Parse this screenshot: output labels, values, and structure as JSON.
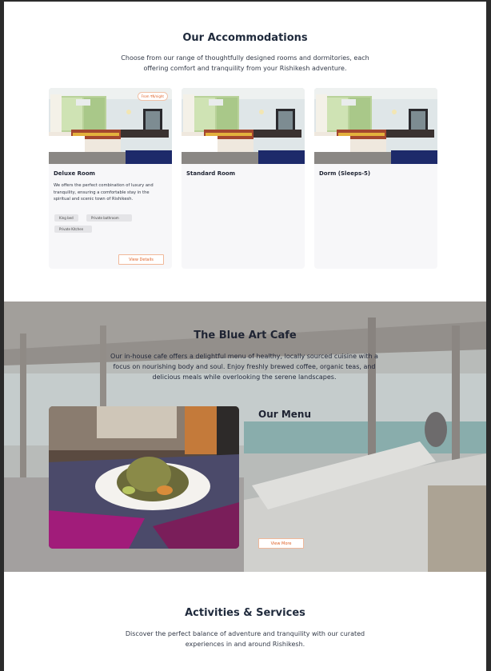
{
  "accommodations": {
    "title": "Our Accommodations",
    "description": "Choose from our range of thoughtfully designed rooms and dormitories, each offering comfort and tranquility from your Rishikesh adventure.",
    "rooms": [
      {
        "name": "Deluxe Room",
        "price_badge": "From ₹N/night",
        "description": "We offers the perfect combination of luxury and tranquility, ensuring a comfortable stay in the spiritual and scenic town of Rishikesh.",
        "amenities": [
          "King bed",
          "Private bathroom",
          "Private Kitchen"
        ],
        "button": "View Details"
      },
      {
        "name": "Standard Room"
      },
      {
        "name": "Dorm (Sleeps-5)"
      }
    ]
  },
  "cafe": {
    "title": "The Blue Art Cafe",
    "description": "Our in-house cafe offers a delightful menu of healthy, locally sourced cuisine with a focus on nourishing body and soul. Enjoy freshly brewed coffee, organic teas, and delicious meals while overlooking the serene landscapes.",
    "menu_title": "Our Menu",
    "button": "View More"
  },
  "activities": {
    "title": "Activities & Services",
    "description": "Discover the perfect balance of adventure and tranquility with our curated experiences in and around Rishikesh."
  }
}
